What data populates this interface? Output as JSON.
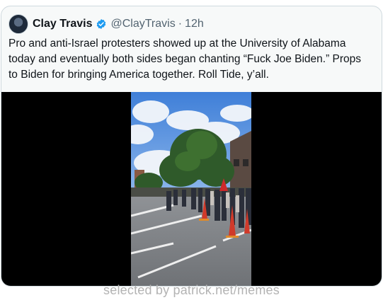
{
  "tweet": {
    "display_name": "Clay Travis",
    "handle": "@ClayTravis",
    "separator": "·",
    "time": "12h",
    "text": "Pro and anti-Israel protesters showed up at the University of Alabama today and eventually both sides began chanting “Fuck Joe Biden.” Props to Biden for bringing America together. Roll Tide, y’all.",
    "verified_color": "#1d9bf0"
  },
  "media": {
    "icon": "video-thumbnail"
  },
  "watermark": "selected by patrick.net/memes"
}
